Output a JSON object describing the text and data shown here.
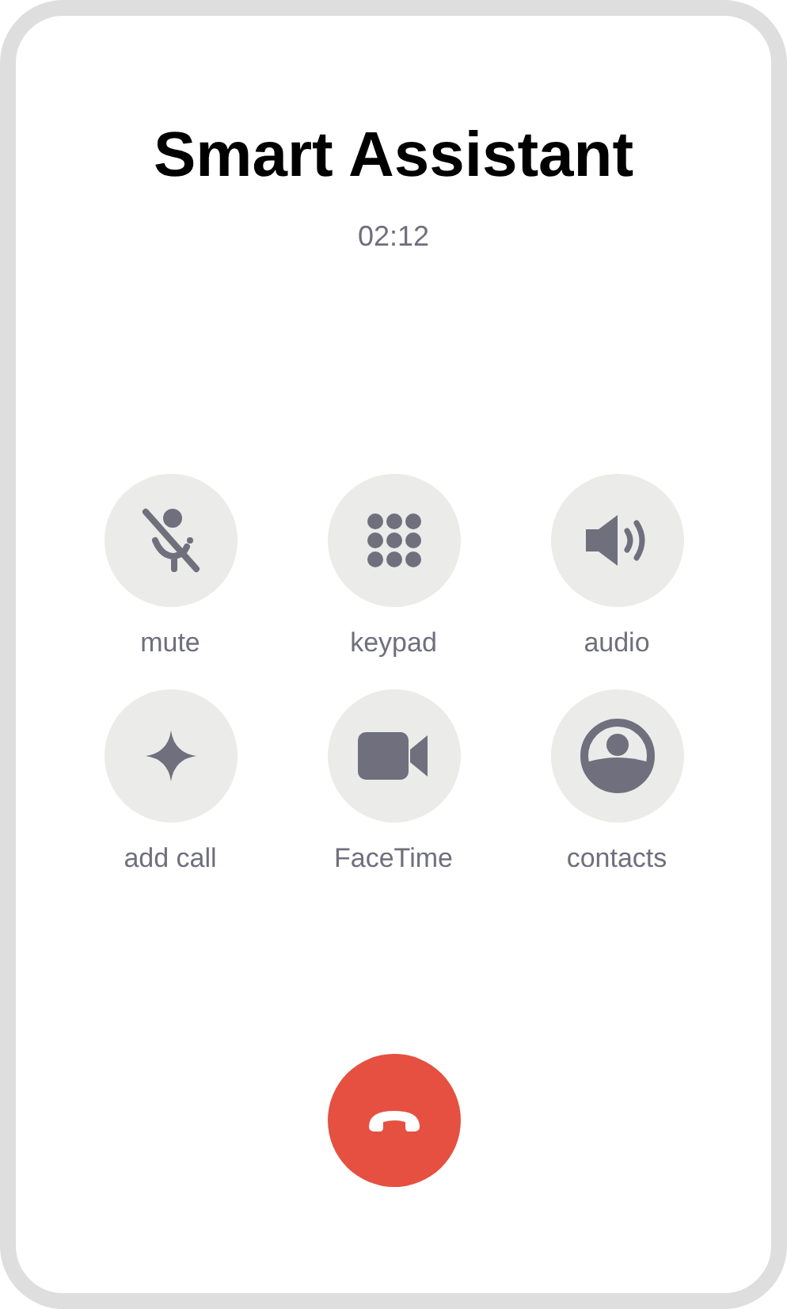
{
  "caller": {
    "name": "Smart Assistant",
    "duration": "02:12"
  },
  "controls": [
    {
      "kind": "mute",
      "label": "mute"
    },
    {
      "kind": "keypad",
      "label": "keypad"
    },
    {
      "kind": "audio",
      "label": "audio"
    },
    {
      "kind": "add",
      "label": "add call"
    },
    {
      "kind": "video",
      "label": "FaceTime"
    },
    {
      "kind": "contacts",
      "label": "contacts"
    }
  ]
}
